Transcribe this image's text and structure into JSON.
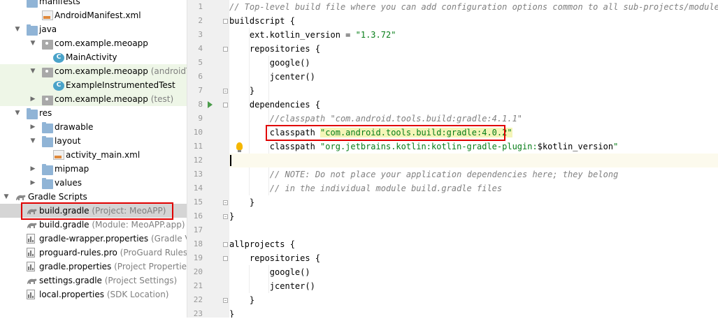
{
  "project_tree": {
    "items": [
      {
        "label": "manifests",
        "secondary": "",
        "type": "folder",
        "expanded": true
      },
      {
        "label": "AndroidManifest.xml",
        "secondary": "",
        "type": "manifest"
      },
      {
        "label": "java",
        "secondary": "",
        "type": "folder",
        "expanded": true
      },
      {
        "label": "com.example.meoapp",
        "secondary": "",
        "type": "package",
        "expanded": true
      },
      {
        "label": "MainActivity",
        "secondary": "",
        "type": "class"
      },
      {
        "label": "com.example.meoapp",
        "secondary": "(androidTest)",
        "type": "package",
        "expanded": true
      },
      {
        "label": "ExampleInstrumentedTest",
        "secondary": "",
        "type": "class"
      },
      {
        "label": "com.example.meoapp",
        "secondary": "(test)",
        "type": "package",
        "expanded": false
      },
      {
        "label": "res",
        "secondary": "",
        "type": "folder",
        "expanded": true
      },
      {
        "label": "drawable",
        "secondary": "",
        "type": "folder",
        "expanded": false
      },
      {
        "label": "layout",
        "secondary": "",
        "type": "folder",
        "expanded": true
      },
      {
        "label": "activity_main.xml",
        "secondary": "",
        "type": "xml"
      },
      {
        "label": "mipmap",
        "secondary": "",
        "type": "folder",
        "expanded": false
      },
      {
        "label": "values",
        "secondary": "",
        "type": "folder",
        "expanded": false
      },
      {
        "label": "Gradle Scripts",
        "secondary": "",
        "type": "gradle",
        "expanded": true
      },
      {
        "label": "build.gradle",
        "secondary": "(Project: MeoAPP)",
        "type": "gradle",
        "selected": true
      },
      {
        "label": "build.gradle",
        "secondary": "(Module: MeoAPP.app)",
        "type": "gradle"
      },
      {
        "label": "gradle-wrapper.properties",
        "secondary": "(Gradle Versio",
        "type": "properties"
      },
      {
        "label": "proguard-rules.pro",
        "secondary": "(ProGuard Rules for",
        "type": "properties"
      },
      {
        "label": "gradle.properties",
        "secondary": "(Project Properties)",
        "type": "properties"
      },
      {
        "label": "settings.gradle",
        "secondary": "(Project Settings)",
        "type": "gradle"
      },
      {
        "label": "local.properties",
        "secondary": "(SDK Location)",
        "type": "properties"
      }
    ]
  },
  "editor": {
    "line_numbers": [
      "1",
      "2",
      "3",
      "4",
      "5",
      "6",
      "7",
      "8",
      "9",
      "10",
      "11",
      "12",
      "13",
      "14",
      "15",
      "16",
      "17",
      "18",
      "19",
      "20",
      "21",
      "22",
      "23"
    ],
    "lines": [
      [
        {
          "t": "// Top-level build file where you can add configuration options common to all sub-projects/modules.",
          "c": "cm"
        }
      ],
      [
        {
          "t": "buildscript {",
          "c": ""
        }
      ],
      [
        {
          "t": "    ext.kotlin_version = ",
          "c": ""
        },
        {
          "t": "\"1.3.72\"",
          "c": "str"
        }
      ],
      [
        {
          "t": "    repositories {",
          "c": ""
        }
      ],
      [
        {
          "t": "        google()",
          "c": ""
        }
      ],
      [
        {
          "t": "        jcenter()",
          "c": ""
        }
      ],
      [
        {
          "t": "    }",
          "c": ""
        }
      ],
      [
        {
          "t": "    dependencies {",
          "c": ""
        }
      ],
      [
        {
          "t": "        //classpath \"com.android.tools.build:gradle:4.1.1\"",
          "c": "cm"
        }
      ],
      [
        {
          "t": "        classpath ",
          "c": ""
        },
        {
          "t": "\"com.android.tools.build:gradle:4.0.2\"",
          "c": "strbg"
        }
      ],
      [
        {
          "t": "        classpath ",
          "c": ""
        },
        {
          "t": "\"org.jetbrains.kotlin:kotlin-gradle-plugin:",
          "c": "str"
        },
        {
          "t": "$kotlin_version",
          "c": ""
        },
        {
          "t": "\"",
          "c": "str"
        }
      ],
      [
        {
          "t": "",
          "c": ""
        }
      ],
      [
        {
          "t": "        // NOTE: Do not place your application dependencies here; they belong",
          "c": "cm"
        }
      ],
      [
        {
          "t": "        // in the individual module build.gradle files",
          "c": "cm"
        }
      ],
      [
        {
          "t": "    }",
          "c": ""
        }
      ],
      [
        {
          "t": "}",
          "c": ""
        }
      ],
      [
        {
          "t": "",
          "c": ""
        }
      ],
      [
        {
          "t": "allprojects {",
          "c": ""
        }
      ],
      [
        {
          "t": "    repositories {",
          "c": ""
        }
      ],
      [
        {
          "t": "        google()",
          "c": ""
        }
      ],
      [
        {
          "t": "        jcenter()",
          "c": ""
        }
      ],
      [
        {
          "t": "    }",
          "c": ""
        }
      ],
      [
        {
          "t": "}",
          "c": ""
        }
      ]
    ],
    "current_line": 12,
    "icons": [
      "run-gutter-icon",
      "intention-bulb-icon"
    ]
  },
  "colors": {
    "comment": "#808080",
    "string": "#067d17",
    "highlight_box": "#e00000",
    "gutter_bg": "#f0f0f0",
    "selected_row": "#d5d5d5",
    "test_package_row": "#eef6e7"
  }
}
